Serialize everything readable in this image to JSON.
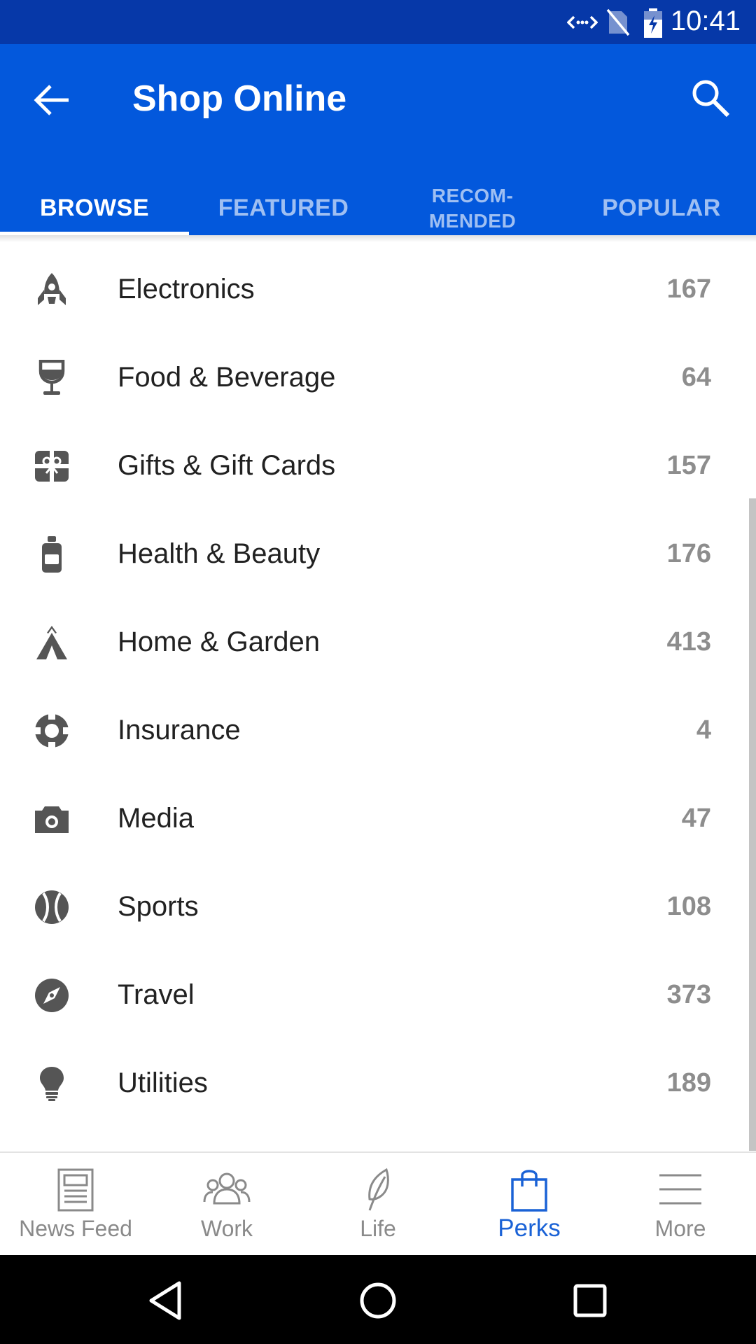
{
  "status_bar": {
    "time": "10:41",
    "icons": [
      "data-transfer-icon",
      "no-sim-icon",
      "battery-charging-icon"
    ]
  },
  "app_bar": {
    "title": "Shop Online",
    "back_icon": "arrow-back-icon",
    "search_icon": "search-icon"
  },
  "tabs": [
    {
      "label": "BROWSE",
      "active": true
    },
    {
      "label": "FEATURED",
      "active": false
    },
    {
      "label": "RECOM-\nMENDED",
      "active": false
    },
    {
      "label": "POPULAR",
      "active": false
    }
  ],
  "categories": [
    {
      "label": "Electronics",
      "count": "167",
      "icon": "rocket-icon"
    },
    {
      "label": "Food & Beverage",
      "count": "64",
      "icon": "wine-glass-icon"
    },
    {
      "label": "Gifts & Gift Cards",
      "count": "157",
      "icon": "gift-card-icon"
    },
    {
      "label": "Health & Beauty",
      "count": "176",
      "icon": "bottle-icon"
    },
    {
      "label": "Home & Garden",
      "count": "413",
      "icon": "tent-icon"
    },
    {
      "label": "Insurance",
      "count": "4",
      "icon": "life-ring-icon"
    },
    {
      "label": "Media",
      "count": "47",
      "icon": "camera-icon"
    },
    {
      "label": "Sports",
      "count": "108",
      "icon": "ball-icon"
    },
    {
      "label": "Travel",
      "count": "373",
      "icon": "compass-icon"
    },
    {
      "label": "Utilities",
      "count": "189",
      "icon": "lightbulb-icon"
    }
  ],
  "bottom_nav": [
    {
      "label": "News Feed",
      "icon": "newspaper-icon",
      "active": false
    },
    {
      "label": "Work",
      "icon": "people-icon",
      "active": false
    },
    {
      "label": "Life",
      "icon": "leaf-icon",
      "active": false
    },
    {
      "label": "Perks",
      "icon": "shopping-bag-icon",
      "active": true
    },
    {
      "label": "More",
      "icon": "menu-icon",
      "active": false
    }
  ],
  "system_nav": [
    "back-triangle-icon",
    "home-circle-icon",
    "recents-square-icon"
  ],
  "colors": {
    "status_bar": "#0638a8",
    "app_bar": "#0358dc",
    "active_nav": "#1a62d6",
    "count_text": "#8d8d8d",
    "icon_gray": "#555555"
  }
}
